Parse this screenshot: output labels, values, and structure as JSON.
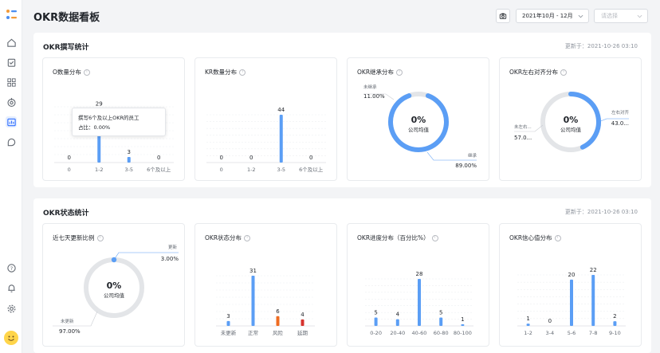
{
  "page": {
    "title": "OKR数据看板"
  },
  "toolbar": {
    "date_range": "2021年10月 - 12月",
    "select_placeholder": "请选择"
  },
  "sidebar": {
    "icons": [
      "home-icon",
      "checklist-icon",
      "grid-icon",
      "target-icon",
      "dashboard-icon",
      "sticker-icon",
      "help-icon",
      "bell-icon",
      "settings-icon"
    ]
  },
  "section1": {
    "title": "OKR撰写统计",
    "updated": "更新于：2021-10-26 03:10",
    "cards": [
      {
        "title": "O数量分布",
        "tooltip_line1": "撰写6个及以上OKR的员工",
        "tooltip_line2": "占比：0.00%"
      },
      {
        "title": "KR数量分布"
      },
      {
        "title": "OKR继承分布",
        "center_value": "0%",
        "center_label": "公司均值",
        "label_a": "未继承",
        "value_a": "11.00%",
        "label_b": "继承",
        "value_b": "89.00%"
      },
      {
        "title": "OKR左右对齐分布",
        "center_value": "0%",
        "center_label": "公司均值",
        "label_a": "左右对齐",
        "value_a": "43.0...",
        "label_b": "未左右...",
        "value_b": "57.0..."
      }
    ]
  },
  "section2": {
    "title": "OKR状态统计",
    "updated": "更新于：2021-10-26 03:10",
    "cards": [
      {
        "title": "近七天更新比例",
        "center_value": "0%",
        "center_label": "公司均值",
        "label_a": "更新",
        "value_a": "3.00%",
        "label_b": "未更新",
        "value_b": "97.00%"
      },
      {
        "title": "OKR状态分布"
      },
      {
        "title": "OKR进度分布（百分比%）"
      },
      {
        "title": "OKR信心值分布"
      }
    ]
  },
  "chart_data": [
    {
      "type": "bar",
      "title": "O数量分布",
      "categories": [
        "0",
        "1-2",
        "3-5",
        "6个及以上"
      ],
      "values": [
        0,
        29,
        3,
        0
      ],
      "ylim": [
        0,
        30
      ]
    },
    {
      "type": "bar",
      "title": "KR数量分布",
      "categories": [
        "0",
        "1-2",
        "3-5",
        "6个及以上"
      ],
      "values": [
        0,
        0,
        44,
        0
      ],
      "ylim": [
        0,
        44
      ]
    },
    {
      "type": "pie",
      "title": "OKR继承分布",
      "categories": [
        "未继承",
        "继承"
      ],
      "values": [
        11.0,
        89.0
      ]
    },
    {
      "type": "pie",
      "title": "OKR左右对齐分布",
      "categories": [
        "左右对齐",
        "未左右对齐"
      ],
      "values": [
        43.0,
        57.0
      ]
    },
    {
      "type": "pie",
      "title": "近七天更新比例",
      "categories": [
        "更新",
        "未更新"
      ],
      "values": [
        3.0,
        97.0
      ]
    },
    {
      "type": "bar",
      "title": "OKR状态分布",
      "categories": [
        "未更新",
        "正常",
        "风险",
        "延期"
      ],
      "values": [
        3,
        31,
        6,
        4
      ],
      "colors": [
        "#5b9ef5",
        "#5b9ef5",
        "#ef6c22",
        "#d6332e"
      ],
      "ylim": [
        0,
        31
      ]
    },
    {
      "type": "bar",
      "title": "OKR进度分布（百分比%）",
      "categories": [
        "0-20",
        "20-40",
        "40-60",
        "60-80",
        "80-100"
      ],
      "values": [
        5,
        4,
        28,
        5,
        1
      ],
      "ylim": [
        0,
        28
      ]
    },
    {
      "type": "bar",
      "title": "OKR信心值分布",
      "categories": [
        "1-2",
        "3-4",
        "5-6",
        "7-8",
        "9-10"
      ],
      "values": [
        1,
        0,
        20,
        22,
        2
      ],
      "ylim": [
        0,
        22
      ]
    }
  ],
  "colors": {
    "accent": "#5b9ef5",
    "ring_track": "#e3e5e8",
    "risk": "#ef6c22",
    "delay": "#d6332e"
  }
}
